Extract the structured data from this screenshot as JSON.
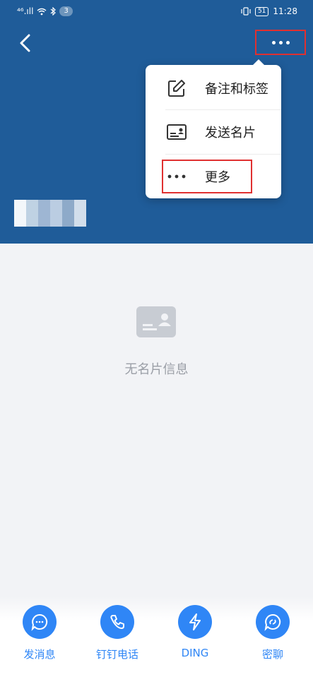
{
  "status_bar": {
    "signal_text": "⁴⁶.ıll",
    "badge": "3",
    "battery": "51",
    "time": "11:28"
  },
  "header": {
    "background_color": "#1f5c99",
    "back_icon": "chevron-left-icon",
    "more_icon": "more-horizontal-icon"
  },
  "popup_menu": {
    "items": [
      {
        "label": "备注和标签",
        "icon": "edit-note-icon"
      },
      {
        "label": "发送名片",
        "icon": "business-card-icon"
      },
      {
        "label": "更多",
        "icon": "more-dots-icon"
      }
    ]
  },
  "empty_state": {
    "icon": "card-placeholder-icon",
    "text": "无名片信息"
  },
  "bottom_actions": [
    {
      "label": "发消息",
      "icon": "chat-bubble-icon"
    },
    {
      "label": "钉钉电话",
      "icon": "phone-icon"
    },
    {
      "label": "DING",
      "icon": "lightning-icon"
    },
    {
      "label": "密聊",
      "icon": "secret-chat-icon"
    }
  ],
  "colors": {
    "accent": "#2f86f6",
    "highlight": "#e03030"
  }
}
